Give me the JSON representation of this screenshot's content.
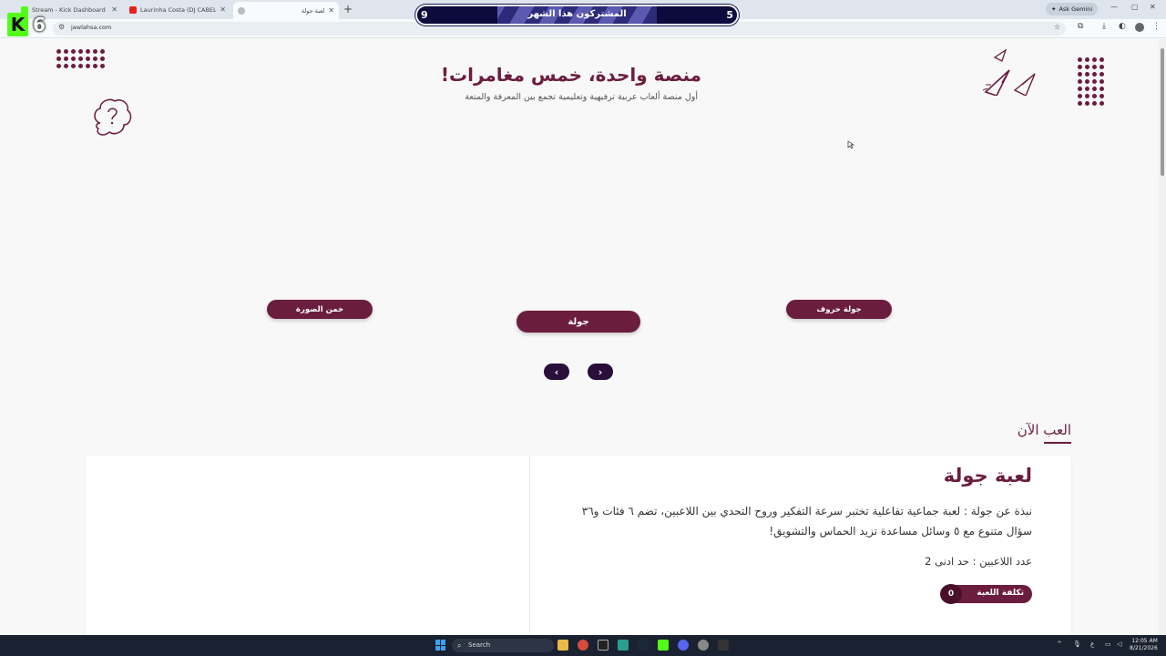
{
  "browser": {
    "tabs": [
      {
        "title": "Stream - Kick Dashboard",
        "active": false
      },
      {
        "title": "Laurinha Costa (DJ CABELO) (D...",
        "active": false
      },
      {
        "title": "لعبة جولة",
        "active": true
      }
    ],
    "new_tab": "+",
    "ask_gemini": "Ask Gemini",
    "url": "jawlahsa.com"
  },
  "overlay": {
    "kick_logo": "K",
    "kick_count": "6",
    "subs_label": "المشتركون هذا الشهر",
    "subs_left": "9",
    "subs_right": "5",
    "subs_progress": 0.5
  },
  "hero": {
    "title": "منصة واحدة، خمس مغامرات!",
    "subtitle": "أول منصة ألعاب عربية ترفيهية وتعليمية تجمع بين المعرفة والمتعة"
  },
  "carousel": {
    "left_label": "خمن الصورة",
    "center_label": "جولة",
    "right_label": "جولة حروف",
    "prev": "‹",
    "next": "›"
  },
  "section": {
    "title": "العب الآن"
  },
  "game_card": {
    "title": "لعبة جولة",
    "description": "نبذة عن جولة : لعبة جماعية تفاعلية تختبر سرعة التفكير وروح التحدي بين اللاعبين، تضم ٦ فئات و٣٦ سؤال متنوع مع ٥ وسائل مساعدة تزيد الحماس والتشويق!",
    "players": "عدد اللاعبين : حد ادنى 2",
    "cost_label": "تكلفة اللعبة",
    "cost_value": "0"
  },
  "taskbar": {
    "search": "Search",
    "time": "12:05 AM",
    "date": "8/21/2026",
    "lang": "ع"
  },
  "colors": {
    "brand": "#6b1d3f",
    "nav_dark": "#2a0f3a",
    "kick_green": "#53fc18"
  }
}
